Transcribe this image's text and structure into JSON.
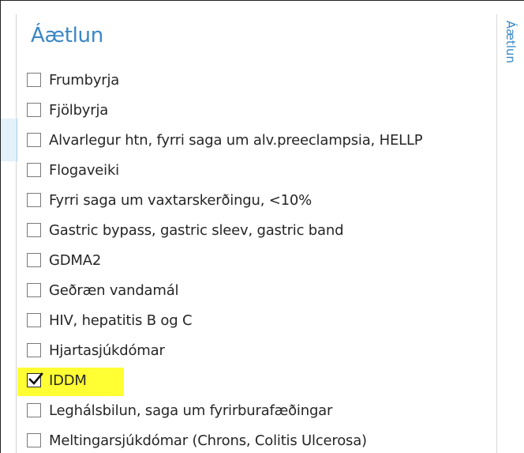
{
  "panel": {
    "title": "Áætlun"
  },
  "side_tab": {
    "label": "Áætlun"
  },
  "options": [
    {
      "label": "Frumbyrja",
      "checked": false
    },
    {
      "label": "Fjölbyrja",
      "checked": false
    },
    {
      "label": "Alvarlegur htn, fyrri saga um alv.preeclampsia, HELLP",
      "checked": false
    },
    {
      "label": "Flogaveiki",
      "checked": false
    },
    {
      "label": "Fyrri saga um vaxtarskerðingu, <10%",
      "checked": false
    },
    {
      "label": "Gastric bypass, gastric sleev, gastric band",
      "checked": false
    },
    {
      "label": "GDMA2",
      "checked": false
    },
    {
      "label": "Geðræn vandamál",
      "checked": false
    },
    {
      "label": "HIV, hepatitis B og C",
      "checked": false
    },
    {
      "label": "Hjartasjúkdómar",
      "checked": false
    },
    {
      "label": "IDDM",
      "checked": true,
      "highlighted": true
    },
    {
      "label": "Leghálsbilun, saga um fyrirburafæðingar",
      "checked": false
    },
    {
      "label": "Meltingarsjúkdómar (Chrons, Colitis Ulcerosa)",
      "checked": false
    }
  ],
  "colors": {
    "accent": "#3a86c4",
    "highlight": "#ffff33",
    "text": "#262626"
  }
}
